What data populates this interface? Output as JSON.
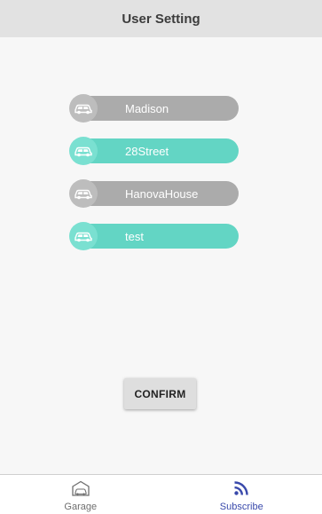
{
  "header": {
    "title": "User Setting"
  },
  "garages": [
    {
      "label": "Madison",
      "selected": false,
      "icon": "car-icon"
    },
    {
      "label": "28Street",
      "selected": true,
      "icon": "car-icon"
    },
    {
      "label": "HanovaHouse",
      "selected": false,
      "icon": "car-icon"
    },
    {
      "label": "test",
      "selected": true,
      "icon": "car-icon"
    }
  ],
  "actions": {
    "confirm_label": "CONFIRM"
  },
  "bottom_nav": {
    "items": [
      {
        "label": "Garage",
        "icon": "garage-icon",
        "active": false
      },
      {
        "label": "Subscribe",
        "icon": "rss-icon",
        "active": true
      }
    ]
  },
  "colors": {
    "selected": "#63d5c4",
    "unselected": "#ababab",
    "nav_active": "#3949ab",
    "header_bg": "#e2e2e2"
  }
}
